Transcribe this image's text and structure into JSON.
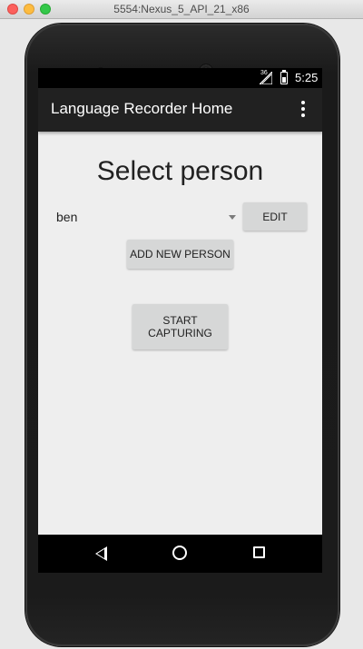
{
  "window": {
    "title": "5554:Nexus_5_API_21_x86"
  },
  "status_bar": {
    "network": "36",
    "time": "5:25",
    "signal_icon": "signal-icon",
    "battery_icon": "battery-icon"
  },
  "action_bar": {
    "title": "Language Recorder Home",
    "overflow_icon": "overflow-menu-icon"
  },
  "main": {
    "heading": "Select person",
    "spinner": {
      "selected": "ben"
    },
    "edit_label": "EDIT",
    "add_label": "ADD NEW PERSON",
    "start_label": "START\nCAPTURING"
  },
  "nav_bar": {
    "back_icon": "back-icon",
    "home_icon": "home-icon",
    "recents_icon": "recents-icon"
  },
  "colors": {
    "action_bar": "#212121",
    "screen_bg": "#eeeeee",
    "button_bg": "#d6d7d7",
    "status_bar": "#000000"
  }
}
